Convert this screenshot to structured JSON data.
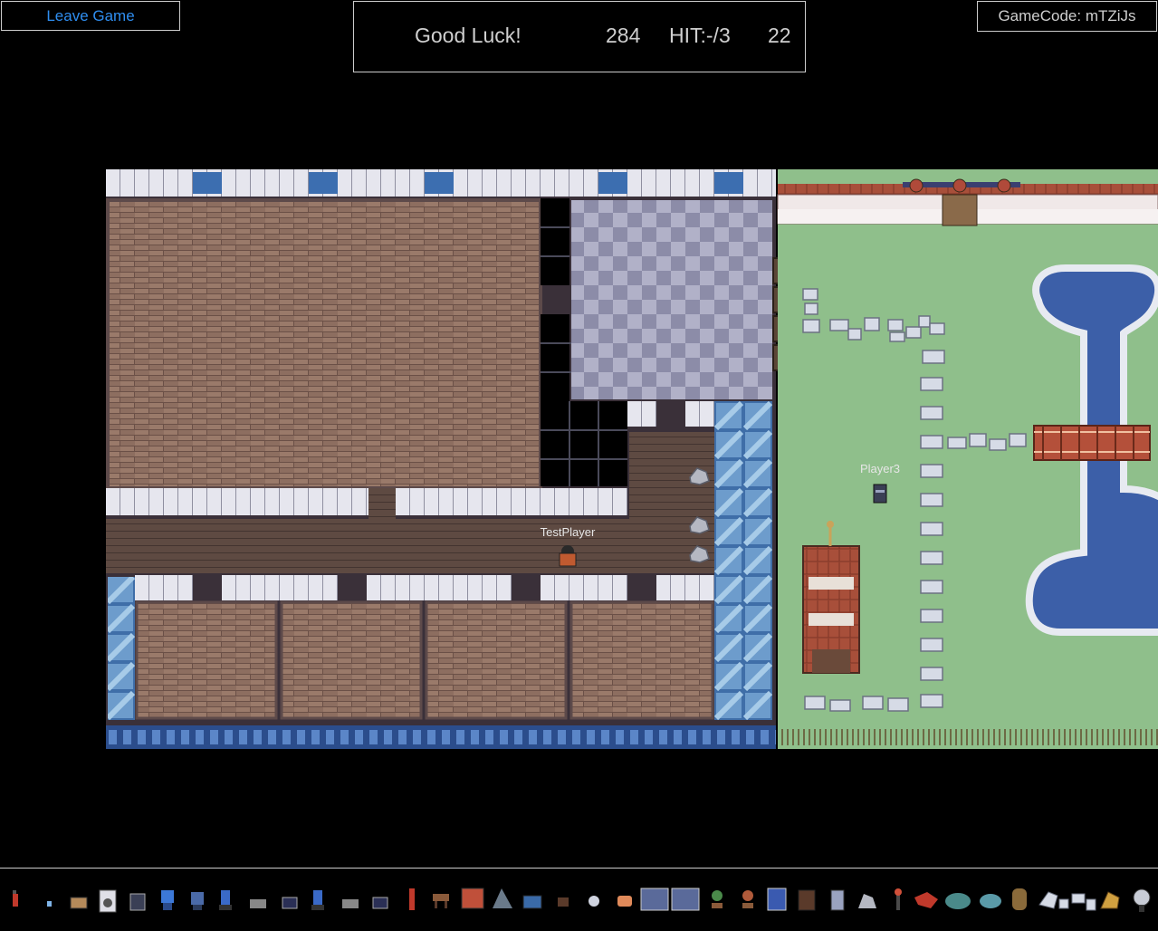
{
  "header": {
    "leave_label": "Leave Game",
    "status_text": "Good Luck!",
    "score": "284",
    "hit_text": "HIT:-/3",
    "timer": "22",
    "gamecode_text": "GameCode: mTZiJs"
  },
  "players": [
    {
      "name": "TestPlayer"
    },
    {
      "name": "Player3"
    }
  ],
  "colors": {
    "accent": "#2f8ef0",
    "grass": "#8fbf8b",
    "water": "#3c5fa8",
    "brick": "#8a6a5c",
    "checker": "#9a9ab5"
  },
  "toolbar": {
    "items": [
      "fire-extinguisher-icon",
      "small-vial-icon",
      "boxes-icon",
      "washing-machine-icon",
      "trash-bin-icon",
      "blue-chair-icon",
      "chair-icon",
      "office-chair-icon",
      "desk-icon",
      "briefcase-icon",
      "office-chair-2-icon",
      "desk-2-icon",
      "briefcase-2-icon",
      "red-lamp-icon",
      "bench-icon",
      "shop-counter-icon",
      "plant-icon",
      "tv-icon",
      "stool-icon",
      "teapot-icon",
      "bread-icon",
      "kitchen-counter-icon",
      "stove-icon",
      "bonsai-icon",
      "bonsai-2-icon",
      "blue-machine-icon",
      "cabinet-icon",
      "robot-icon",
      "rock-icon",
      "lamp-post-icon",
      "red-dragon-icon",
      "bush-icon",
      "bush-2-icon",
      "owl-statue-icon",
      "stone-path-icon",
      "stone-path-2-icon",
      "gold-ore-icon",
      "grill-icon"
    ]
  }
}
